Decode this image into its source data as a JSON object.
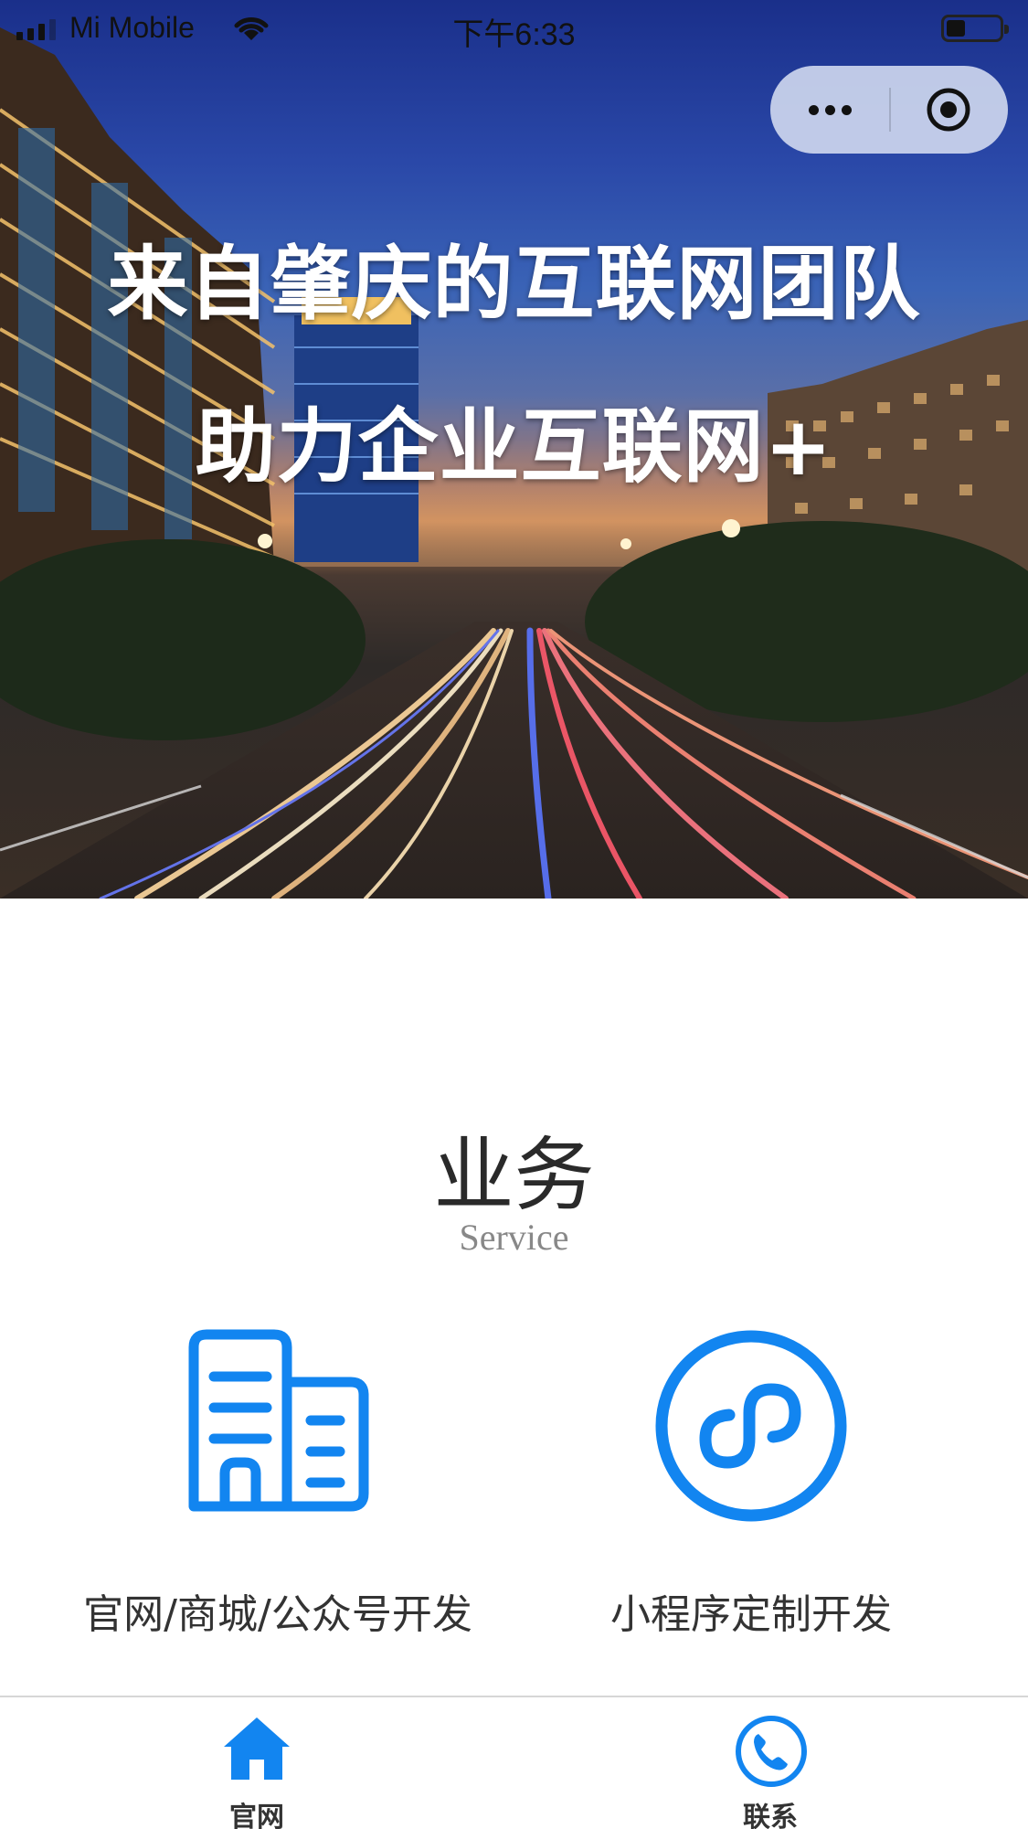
{
  "status_bar": {
    "carrier": "Mi Mobile",
    "time": "下午6:33",
    "battery_level": 0.35
  },
  "capsule": {
    "more_icon": "more-dots-icon",
    "close_icon": "target-circle-icon"
  },
  "hero": {
    "title": "来自肇庆的互联网团队",
    "subtitle": "助力企业互联网+"
  },
  "service": {
    "title": "业务",
    "subtitle": "Service",
    "items": [
      {
        "label": "官网/商城/公众号开发",
        "icon": "building-icon"
      },
      {
        "label": "小程序定制开发",
        "icon": "mini-program-icon"
      }
    ]
  },
  "tab_bar": {
    "tabs": [
      {
        "label": "官网",
        "icon": "home-icon",
        "active": true
      },
      {
        "label": "联系",
        "icon": "phone-icon",
        "active": false
      }
    ]
  },
  "colors": {
    "accent": "#1285f0",
    "text_dark": "#2a2a2a",
    "text_muted": "#888888"
  }
}
